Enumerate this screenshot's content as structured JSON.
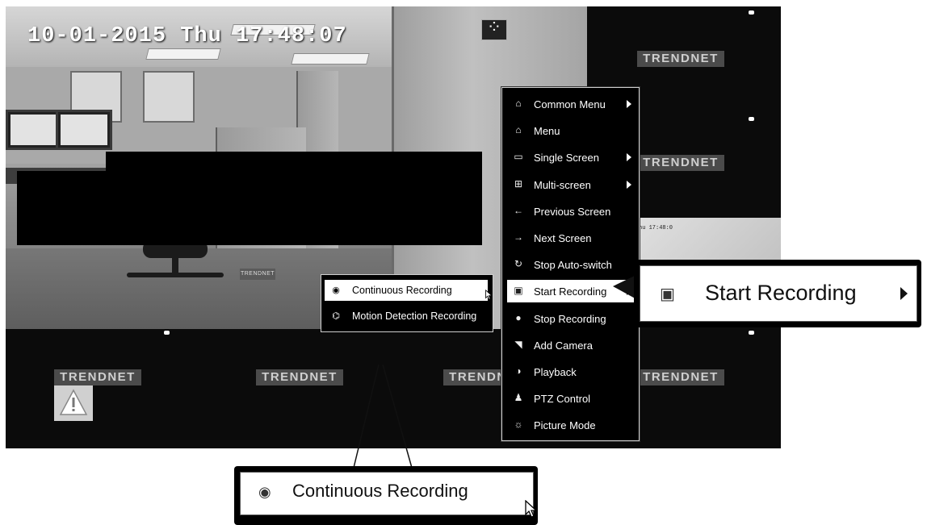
{
  "overlay": {
    "timestamp": "10-01-2015 Thu 17:48:07",
    "cam4_timestamp": "hu 17:48:0"
  },
  "brand": {
    "name": "TRENDNET",
    "small_name": "TRENDNET"
  },
  "context_menu": {
    "items": [
      {
        "label": "Common Menu",
        "icon": "common-menu-icon",
        "glyph": "⌂",
        "has_submenu": true
      },
      {
        "label": "Menu",
        "icon": "home-icon",
        "glyph": "⌂",
        "has_submenu": false
      },
      {
        "label": "Single Screen",
        "icon": "single-screen-icon",
        "glyph": "▭",
        "has_submenu": true
      },
      {
        "label": "Multi-screen",
        "icon": "multi-screen-icon",
        "glyph": "⊞",
        "has_submenu": true
      },
      {
        "label": "Previous Screen",
        "icon": "arrow-left-icon",
        "glyph": "←",
        "has_submenu": false
      },
      {
        "label": "Next Screen",
        "icon": "arrow-right-icon",
        "glyph": "→",
        "has_submenu": false
      },
      {
        "label": "Stop Auto-switch",
        "icon": "auto-switch-icon",
        "glyph": "↻",
        "has_submenu": false
      },
      {
        "label": "Start Recording",
        "icon": "start-recording-icon",
        "glyph": "▣",
        "has_submenu": true,
        "active": true
      },
      {
        "label": "Stop Recording",
        "icon": "stop-recording-icon",
        "glyph": "●",
        "has_submenu": false
      },
      {
        "label": "Add Camera",
        "icon": "add-camera-icon",
        "glyph": "◥",
        "has_submenu": false
      },
      {
        "label": "Playback",
        "icon": "playback-icon",
        "glyph": "◑",
        "has_submenu": false
      },
      {
        "label": "PTZ Control",
        "icon": "ptz-icon",
        "glyph": "♟",
        "has_submenu": false
      },
      {
        "label": "Picture Mode",
        "icon": "picture-mode-icon",
        "glyph": "☼",
        "has_submenu": false
      }
    ]
  },
  "submenu": {
    "items": [
      {
        "label": "Continuous Recording",
        "icon": "continuous-recording-icon",
        "glyph": "◉",
        "active": true
      },
      {
        "label": "Motion Detection Recording",
        "icon": "motion-detection-icon",
        "glyph": "⌬",
        "active": false
      }
    ]
  },
  "callouts": {
    "right_label": "Start Recording",
    "bottom_label": "Continuous Recording"
  },
  "colors": {
    "menu_bg": "#000000",
    "menu_text": "#ffffff",
    "highlight_bg": "#ffffff"
  }
}
